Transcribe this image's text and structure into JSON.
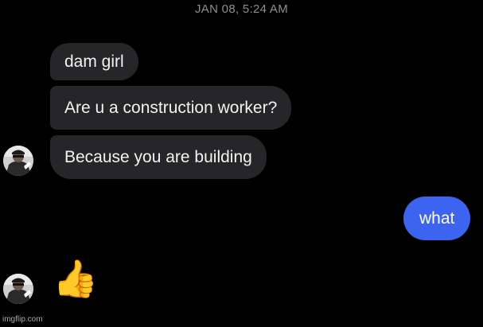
{
  "timestamp": "JAN 08, 5:24 AM",
  "messages": [
    {
      "side": "received",
      "text": "dam girl"
    },
    {
      "side": "received",
      "text": "Are u a construction worker?"
    },
    {
      "side": "received",
      "text": "Because you are building"
    },
    {
      "side": "sent",
      "text": "what"
    },
    {
      "side": "received",
      "text": "👍"
    }
  ],
  "watermark": "imgflip.com",
  "colors": {
    "background": "#000000",
    "received_bubble": "#262628",
    "sent_bubble": "#3d64f0",
    "timestamp": "#8e8e93"
  },
  "icons": {
    "avatar": "user-avatar-photo",
    "reaction": "thumbs-up-emoji"
  }
}
